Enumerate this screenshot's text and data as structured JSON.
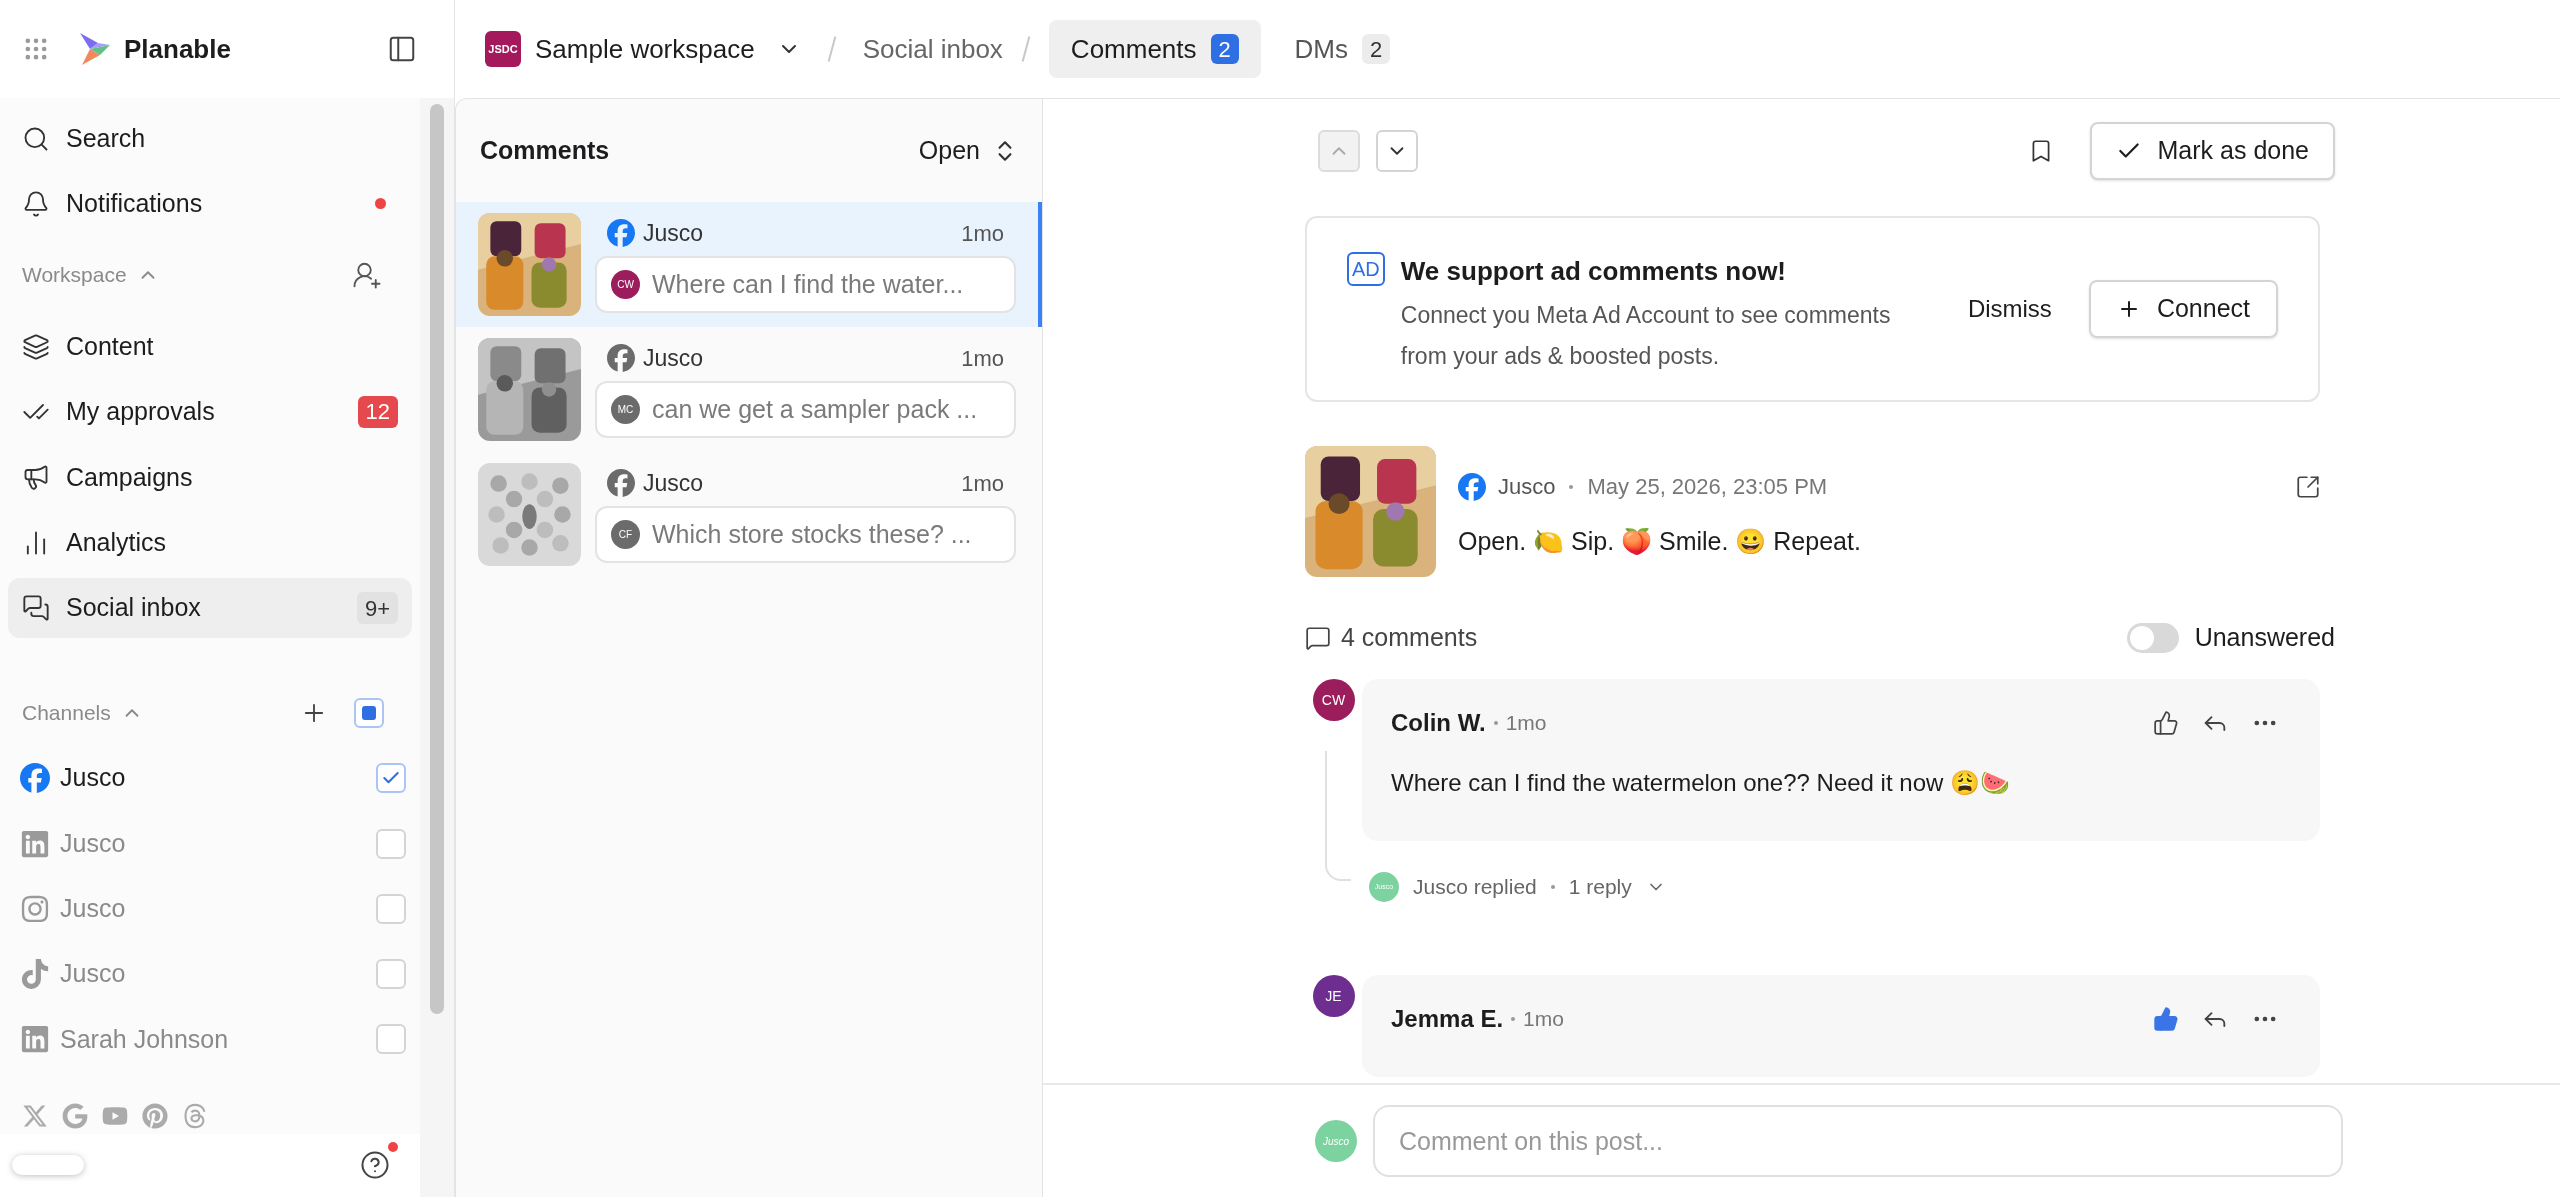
{
  "app": {
    "name": "Planable"
  },
  "sidebar": {
    "top_items": [
      {
        "label": "Search",
        "unread": false
      },
      {
        "label": "Notifications",
        "unread": true
      }
    ],
    "workspace": {
      "title": "Workspace",
      "expanded": true,
      "items": [
        {
          "label": "Content",
          "selected": false
        },
        {
          "label": "My approvals",
          "selected": false,
          "badge": {
            "text": "12",
            "kind": "alert"
          }
        },
        {
          "label": "Campaigns",
          "selected": false
        },
        {
          "label": "Analytics",
          "selected": false
        },
        {
          "label": "Social inbox",
          "selected": true,
          "badge": {
            "text": "9+",
            "kind": "neutral"
          }
        }
      ]
    },
    "channels": {
      "title": "Channels",
      "expanded": true,
      "all_checked": false,
      "some_checked": true,
      "items": [
        {
          "name": "Jusco",
          "kind": "facebook",
          "checked": true
        },
        {
          "name": "Jusco",
          "kind": "linkedin",
          "checked": false
        },
        {
          "name": "Jusco",
          "kind": "instagram",
          "checked": false
        },
        {
          "name": "Jusco",
          "kind": "tiktok",
          "checked": false
        },
        {
          "name": "Sarah Johnson",
          "kind": "linkedin",
          "checked": false
        }
      ]
    },
    "help": {
      "unread": true
    }
  },
  "topbar": {
    "workspace": {
      "initials": "JSDC",
      "name": "Sample workspace"
    },
    "crumb": "Social inbox",
    "tabs": [
      {
        "label": "Comments",
        "count": "2",
        "selected": true
      },
      {
        "label": "DMs",
        "count": "2",
        "selected": false
      }
    ]
  },
  "list": {
    "title": "Comments",
    "filter": "Open",
    "items": [
      {
        "author": "Jusco",
        "time": "1mo",
        "initials": "CW",
        "color": "#9b1d5c",
        "preview": "Where can I find the water...",
        "selected": true
      },
      {
        "author": "Jusco",
        "time": "1mo",
        "initials": "MC",
        "color": "#6b6b6b",
        "preview": "can we get a sampler pack ...",
        "selected": false
      },
      {
        "author": "Jusco",
        "time": "1mo",
        "initials": "CF",
        "color": "#6b6b6b",
        "preview": "Which store stocks these? ...",
        "selected": false
      }
    ]
  },
  "panel": {
    "nav": [
      {
        "kind": "up",
        "disabled": true
      },
      {
        "kind": "down",
        "disabled": false
      }
    ],
    "bookmarked": false,
    "done_button": "Mark as done",
    "banner": {
      "badge": "AD",
      "title": "We support ad comments now!",
      "body": "Connect you Meta Ad Account to see comments from your ads & boosted posts.",
      "dismiss": "Dismiss",
      "connect": "Connect"
    },
    "post": {
      "author": "Jusco",
      "date": "May 25, 2026, 23:05 PM",
      "text": "Open. 🍋 Sip. 🍑 Smile. 😀 Repeat."
    },
    "comments_count": "4 comments",
    "unanswered": {
      "label": "Unanswered",
      "on": false
    },
    "comments": [
      {
        "initials": "CW",
        "color": "#9b1d5c",
        "name": "Colin W.",
        "time": "1mo",
        "text": "Where can I find the watermelon one?? Need it now 😩🍉",
        "liked": false,
        "reply": {
          "avatar": "Jusco",
          "by": "Jusco replied",
          "count": "1 reply"
        }
      },
      {
        "initials": "JE",
        "color": "#6d2e8f",
        "name": "Jemma E.",
        "time": "1mo",
        "liked": true
      }
    ],
    "composer": {
      "avatar": "Jusco",
      "placeholder": "Comment on this post..."
    }
  }
}
